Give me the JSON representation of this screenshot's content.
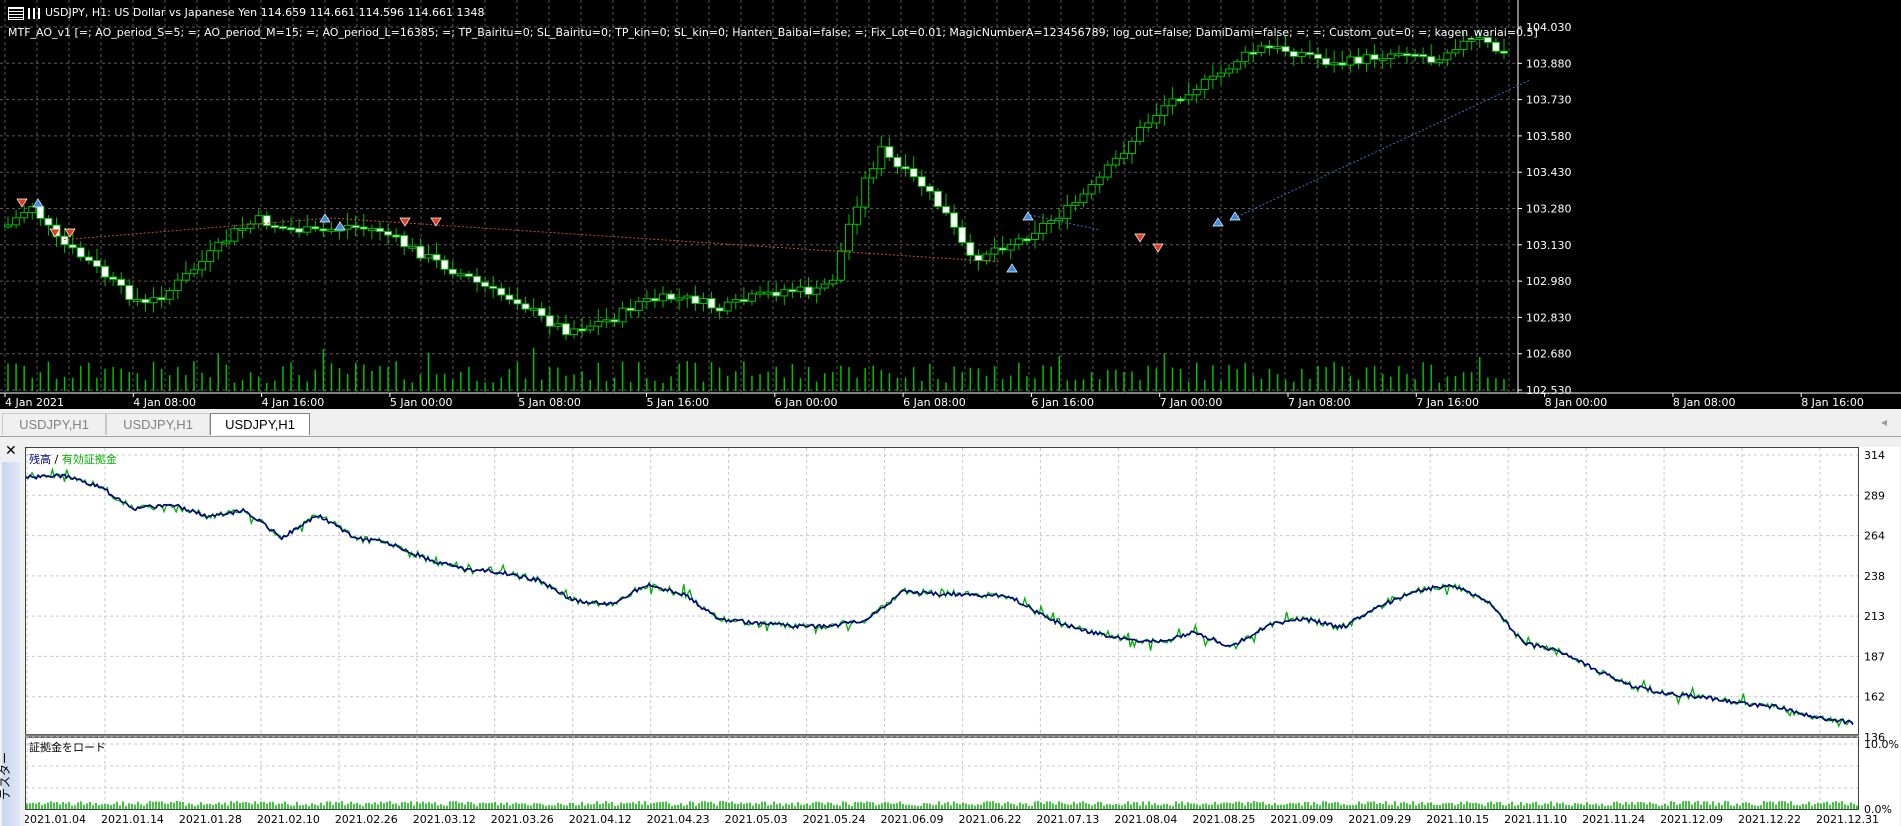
{
  "chart": {
    "symbol_line": "USDJPY, H1:  US Dollar vs Japanese Yen  114.659 114.661 114.596 114.661  1348",
    "indicator_line": "MTF_AO_v1 [=; AO_period_S=5; =; AO_period_M=15; =; AO_period_L=16385; =; TP_Bairitu=0; SL_Bairitu=0; TP_kin=0; SL_kin=0; Hanten_Baibai=false; =; Fix_Lot=0.01; MagicNumberA=123456789; log_out=false; DamiDami=false; =; =; Custom_out=0; =; kagen_wariai=0.5]",
    "price_labels": [
      "104.030",
      "103.880",
      "103.730",
      "103.580",
      "103.430",
      "103.280",
      "103.130",
      "102.980",
      "102.830",
      "102.680",
      "102.530"
    ],
    "time_labels": [
      "4 Jan 2021",
      "4 Jan 08:00",
      "4 Jan 16:00",
      "5 Jan 00:00",
      "5 Jan 08:00",
      "5 Jan 16:00",
      "6 Jan 00:00",
      "6 Jan 08:00",
      "6 Jan 16:00",
      "7 Jan 00:00",
      "7 Jan 08:00",
      "7 Jan 16:00",
      "8 Jan 00:00",
      "8 Jan 08:00",
      "8 Jan 16:00"
    ],
    "colors": {
      "background": "#000000",
      "grid": "#5a5a5a",
      "bull": "#00c000",
      "bear_body": "#ffffff",
      "volume": "#00c000",
      "sell_arrow": "#e04020",
      "buy_arrow": "#3c8ce0"
    }
  },
  "tabs": [
    {
      "label": "USDJPY,H1",
      "active": false
    },
    {
      "label": "USDJPY,H1",
      "active": false
    },
    {
      "label": "USDJPY,H1",
      "active": true
    }
  ],
  "tester": {
    "side_label": "テスター",
    "legend_balance": "残高",
    "legend_sep": "/",
    "legend_equity": "有効証拠金",
    "load_label": "証拠金をロード",
    "equity_y_labels": [
      "314",
      "289",
      "264",
      "238",
      "213",
      "187",
      "162",
      "136"
    ],
    "load_y_labels": [
      "10.0%",
      "0.0%"
    ],
    "date_labels": [
      "2021.01.04",
      "2021.01.14",
      "2021.01.28",
      "2021.02.10",
      "2021.02.26",
      "2021.03.12",
      "2021.03.26",
      "2021.04.12",
      "2021.04.23",
      "2021.05.03",
      "2021.05.24",
      "2021.06.09",
      "2021.06.22",
      "2021.07.13",
      "2021.08.04",
      "2021.08.25",
      "2021.09.09",
      "2021.09.29",
      "2021.10.15",
      "2021.11.10",
      "2021.11.24",
      "2021.12.09",
      "2021.12.22",
      "2021.12.31"
    ],
    "colors": {
      "balance": "#00007f",
      "equity": "#00b000",
      "load": "#00b000",
      "grid": "#c8c8c8"
    }
  },
  "chart_data": {
    "type": "line",
    "series": [
      {
        "name": "残高",
        "values": [
          300,
          301,
          294,
          280,
          283,
          275,
          279,
          262,
          276,
          262,
          258,
          248,
          242,
          240,
          235,
          222,
          220,
          232,
          226,
          210,
          208,
          206,
          206,
          210,
          228,
          226,
          226,
          224,
          210,
          203,
          198,
          196,
          202,
          193,
          207,
          211,
          205,
          218,
          228,
          232,
          222,
          195,
          190,
          178,
          168,
          163,
          161,
          157,
          155,
          148,
          145
        ]
      }
    ],
    "ylim": [
      136,
      314
    ]
  }
}
